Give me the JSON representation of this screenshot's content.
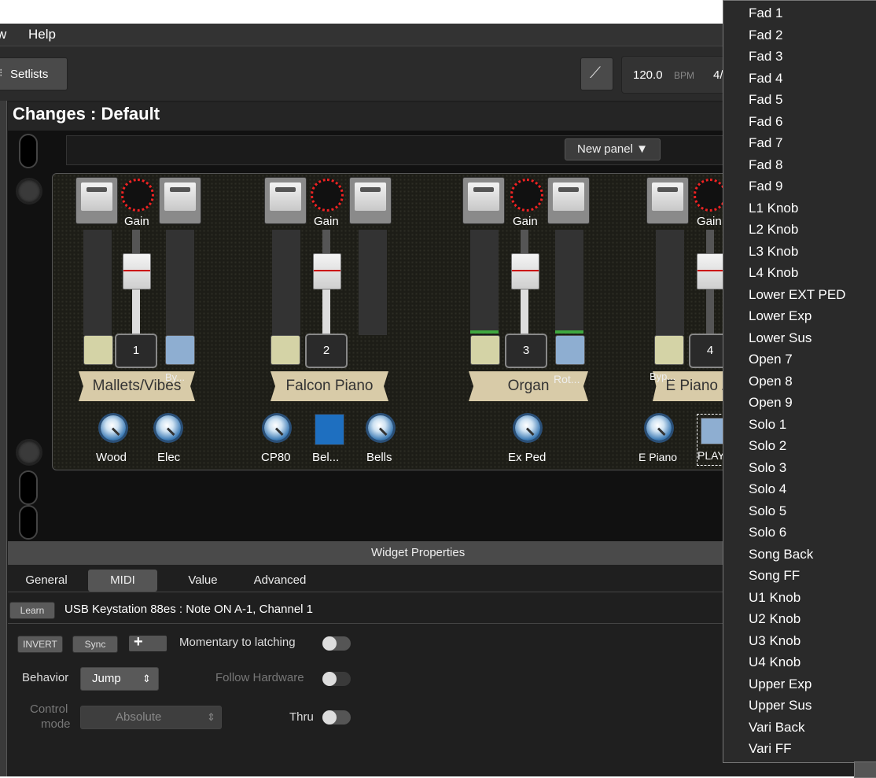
{
  "menubar": {
    "view_partial": "w",
    "help": "Help"
  },
  "toolbar": {
    "setlists_label": "Setlists",
    "tuner_icon": "tuning-fork-icon",
    "tempo_value": "120.0",
    "tempo_unit": "BPM",
    "time_sig_partial": "4/"
  },
  "rack": {
    "title": "Changes : Default",
    "panel_selector": "New panel ▼",
    "strips": [
      {
        "gain": "Gain",
        "number": "1",
        "name": "Mallets/Vibes",
        "right_tag": "By...",
        "knobs": [
          {
            "label": "Wood"
          },
          {
            "label": "Elec"
          }
        ]
      },
      {
        "gain": "Gain",
        "number": "2",
        "name": "Falcon Piano",
        "knobs": [
          {
            "label": "CP80"
          },
          {
            "label": "Bel..."
          },
          {
            "label": "Bells"
          }
        ]
      },
      {
        "gain": "Gain",
        "number": "3",
        "name": "Organ",
        "right_tag": "Rot...",
        "knobs": [
          {
            "label": "Ex Ped"
          }
        ]
      },
      {
        "gain": "Gain",
        "number": "4",
        "name": "E Piano /",
        "left_tag": "Byp...",
        "knobs": [
          {
            "label": "E Piano"
          },
          {
            "label": "PLAY"
          }
        ]
      }
    ]
  },
  "widget_properties": {
    "header": "Widget Properties",
    "tabs": [
      "General",
      "MIDI",
      "Value",
      "Advanced"
    ],
    "active_tab": "MIDI",
    "learn_label": "Learn",
    "midi_binding": "USB Keystation 88es : Note ON A-1, Channel 1",
    "invert_label": "INVERT",
    "sync_label": "Sync",
    "momentary_label": "Momentary to latching",
    "behavior_label": "Behavior",
    "behavior_value": "Jump",
    "follow_hw_label": "Follow Hardware",
    "control_mode_label_1": "Control",
    "control_mode_label_2": "mode",
    "control_mode_value": "Absolute",
    "thru_label": "Thru"
  },
  "dropdown": {
    "items": [
      "Fad 1",
      "Fad 2",
      "Fad 3",
      "Fad 4",
      "Fad 5",
      "Fad 6",
      "Fad 7",
      "Fad 8",
      "Fad 9",
      "L1 Knob",
      "L2 Knob",
      "L3 Knob",
      "L4 Knob",
      "Lower EXT PED",
      "Lower Exp",
      "Lower Sus",
      "Open 7",
      "Open 8",
      "Open 9",
      "Solo 1",
      "Solo 2",
      "Solo 3",
      "Solo 4",
      "Solo 5",
      "Solo 6",
      "Song Back",
      "Song FF",
      "U1 Knob",
      "U2 Knob",
      "U3 Knob",
      "U4 Knob",
      "Upper Exp",
      "Upper Sus",
      "Vari Back",
      "Vari FF"
    ]
  },
  "colors": {
    "accent_blue": "#1e6fc0",
    "knob_red": "#e22222",
    "banner": "#d8cba8"
  }
}
